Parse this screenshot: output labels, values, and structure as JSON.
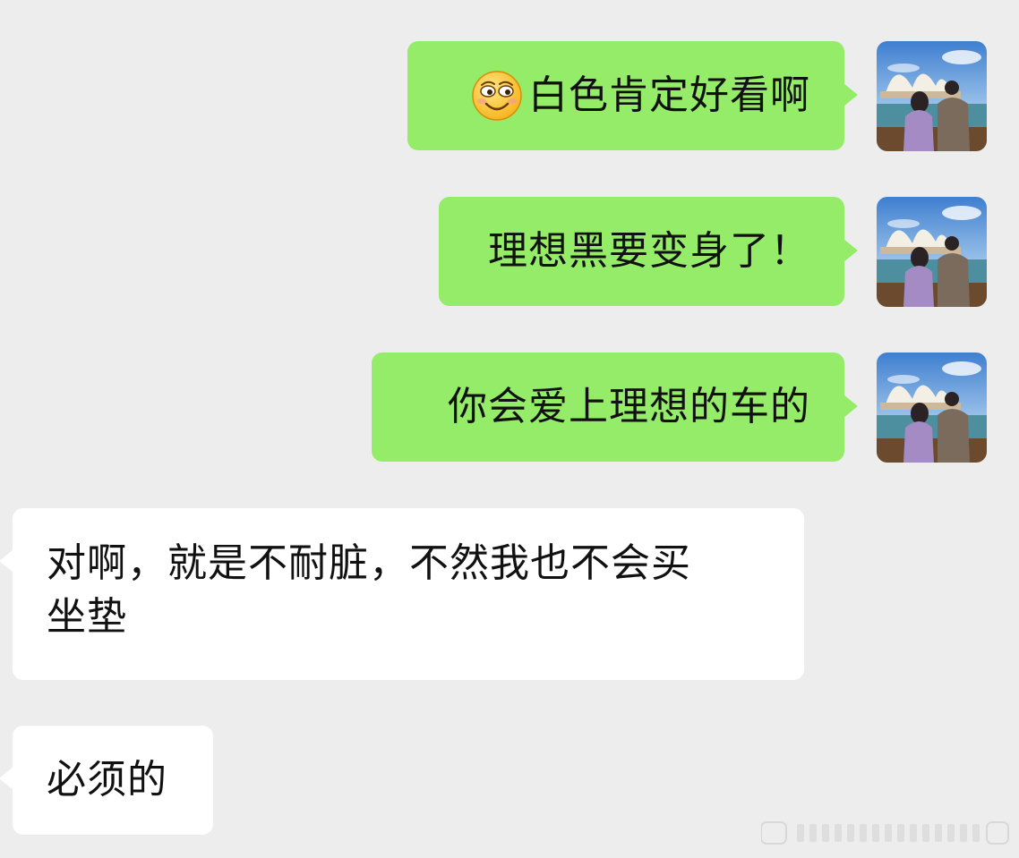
{
  "messages": [
    {
      "direction": "outgoing",
      "text": "白色肯定好看啊",
      "emoji": "smiling-face-emoji"
    },
    {
      "direction": "outgoing",
      "text": "理想黑要变身了！"
    },
    {
      "direction": "outgoing",
      "text": "你会爱上理想的车的"
    },
    {
      "direction": "incoming",
      "text": "对啊，就是不耐脏，不然我也不会买\n坐垫"
    },
    {
      "direction": "incoming",
      "text": "必须的"
    }
  ],
  "colors": {
    "background": "#ededed",
    "outgoing_bubble": "#95ec69",
    "incoming_bubble": "#ffffff",
    "text": "#111111"
  },
  "avatar": {
    "icon": "user-avatar-opera-house-photo"
  }
}
